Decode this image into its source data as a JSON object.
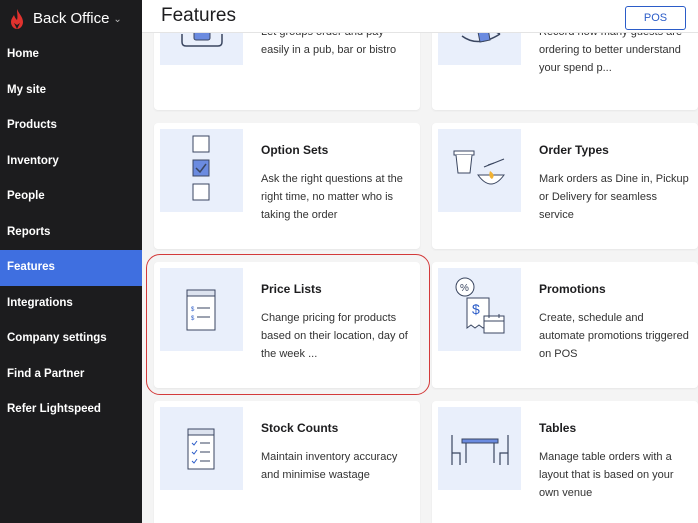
{
  "app": {
    "brand": "Back Office"
  },
  "sidebar": {
    "items": [
      {
        "label": "Home"
      },
      {
        "label": "My site"
      },
      {
        "label": "Products"
      },
      {
        "label": "Inventory"
      },
      {
        "label": "People"
      },
      {
        "label": "Reports"
      },
      {
        "label": "Features"
      },
      {
        "label": "Integrations"
      },
      {
        "label": "Company settings"
      },
      {
        "label": "Find a Partner"
      },
      {
        "label": "Refer Lightspeed"
      }
    ],
    "active": "Features"
  },
  "header": {
    "title": "Features",
    "pos_label": "POS"
  },
  "cards": {
    "group_ordering": {
      "desc": "Let groups order and pay easily in a pub, bar or bistro"
    },
    "guest_count": {
      "desc": "Record how many guests are ordering to better understand your spend p..."
    },
    "option_sets": {
      "title": "Option Sets",
      "desc": "Ask the right questions at the right time, no matter who is taking the order"
    },
    "order_types": {
      "title": "Order Types",
      "desc": "Mark orders as Dine in, Pickup or Delivery for seamless service"
    },
    "price_lists": {
      "title": "Price Lists",
      "desc": "Change pricing for products based on their location, day of the week ..."
    },
    "promotions": {
      "title": "Promotions",
      "desc": "Create, schedule and automate promotions triggered on POS"
    },
    "stock_counts": {
      "title": "Stock Counts",
      "desc": "Maintain inventory accuracy and minimise wastage"
    },
    "tables": {
      "title": "Tables",
      "desc": "Manage table orders with a layout that is based on your own venue"
    }
  },
  "colors": {
    "sidebar_bg": "#1c1c1e",
    "active_nav": "#3f6fe0",
    "accent": "#2b5cc8",
    "highlight": "#d33a3a",
    "icon_bg": "#e9effb"
  }
}
